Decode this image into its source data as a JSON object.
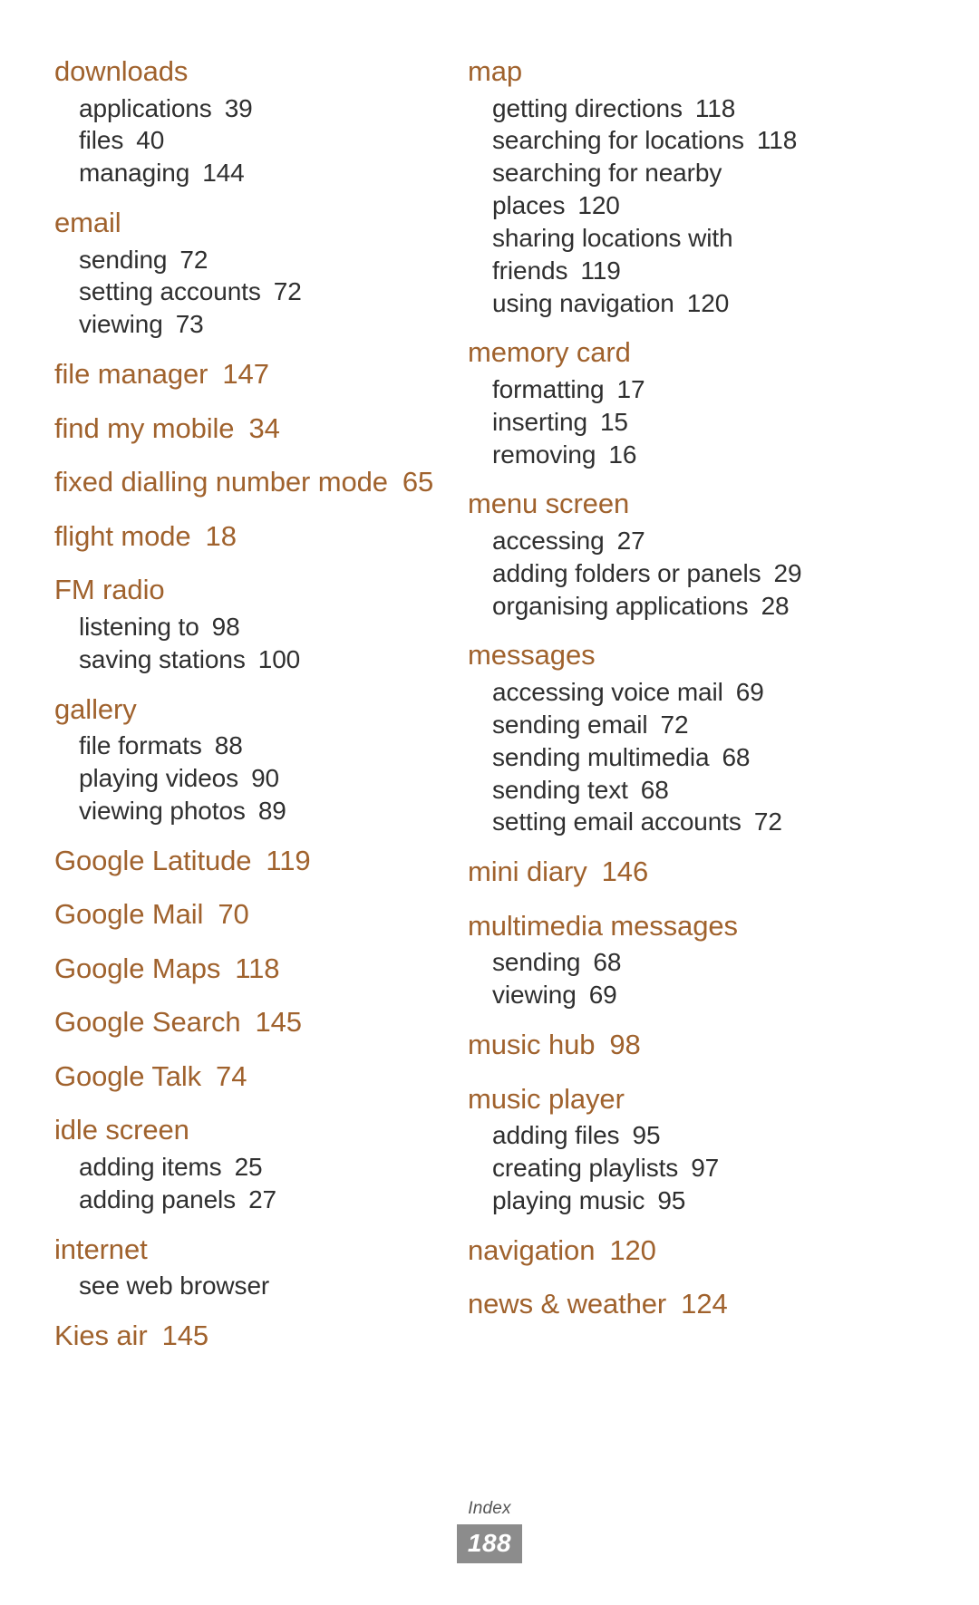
{
  "footer": {
    "label": "Index",
    "page_number": "188"
  },
  "colors": {
    "heading": "#a0622d",
    "entry": "#2f2f2f",
    "page_badge_bg": "#8c8c8c",
    "page_badge_text": "#ffffff",
    "background": "#ffffff"
  },
  "columns": [
    {
      "id": "left",
      "groups": [
        {
          "term": "downloads",
          "page": "",
          "entries": [
            {
              "term": "applications",
              "page": "39"
            },
            {
              "term": "files",
              "page": "40"
            },
            {
              "term": "managing",
              "page": "144"
            }
          ]
        },
        {
          "term": "email",
          "page": "",
          "entries": [
            {
              "term": "sending",
              "page": "72"
            },
            {
              "term": "setting accounts",
              "page": "72"
            },
            {
              "term": "viewing",
              "page": "73"
            }
          ]
        },
        {
          "term": "file manager",
          "page": "147",
          "entries": []
        },
        {
          "term": "find my mobile",
          "page": "34",
          "entries": []
        },
        {
          "term": "fixed dialling number mode",
          "page": "65",
          "entries": []
        },
        {
          "term": "flight mode",
          "page": "18",
          "entries": []
        },
        {
          "term": "FM radio",
          "page": "",
          "entries": [
            {
              "term": "listening to",
              "page": "98"
            },
            {
              "term": "saving stations",
              "page": "100"
            }
          ]
        },
        {
          "term": "gallery",
          "page": "",
          "entries": [
            {
              "term": "file formats",
              "page": "88"
            },
            {
              "term": "playing videos",
              "page": "90"
            },
            {
              "term": "viewing photos",
              "page": "89"
            }
          ]
        },
        {
          "term": "Google Latitude",
          "page": "119",
          "entries": []
        },
        {
          "term": "Google Mail",
          "page": "70",
          "entries": []
        },
        {
          "term": "Google Maps",
          "page": "118",
          "entries": []
        },
        {
          "term": "Google Search",
          "page": "145",
          "entries": []
        },
        {
          "term": "Google Talk",
          "page": "74",
          "entries": []
        },
        {
          "term": "idle screen",
          "page": "",
          "entries": [
            {
              "term": "adding items",
              "page": "25"
            },
            {
              "term": "adding panels",
              "page": "27"
            }
          ]
        },
        {
          "term": "internet",
          "page": "",
          "entries": [
            {
              "term": "see web browser",
              "page": ""
            }
          ]
        },
        {
          "term": "Kies air",
          "page": "145",
          "entries": []
        }
      ]
    },
    {
      "id": "right",
      "groups": [
        {
          "term": "map",
          "page": "",
          "entries": [
            {
              "term": "getting directions",
              "page": "118"
            },
            {
              "term": "searching for locations",
              "page": "118"
            },
            {
              "term": "searching for nearby places",
              "page": "120"
            },
            {
              "term": "sharing locations with friends",
              "page": "119"
            },
            {
              "term": "using navigation",
              "page": "120"
            }
          ]
        },
        {
          "term": "memory card",
          "page": "",
          "entries": [
            {
              "term": "formatting",
              "page": "17"
            },
            {
              "term": "inserting",
              "page": "15"
            },
            {
              "term": "removing",
              "page": "16"
            }
          ]
        },
        {
          "term": "menu screen",
          "page": "",
          "entries": [
            {
              "term": "accessing",
              "page": "27"
            },
            {
              "term": "adding folders or panels",
              "page": "29"
            },
            {
              "term": "organising applications",
              "page": "28"
            }
          ]
        },
        {
          "term": "messages",
          "page": "",
          "entries": [
            {
              "term": "accessing voice mail",
              "page": "69"
            },
            {
              "term": "sending email",
              "page": "72"
            },
            {
              "term": "sending multimedia",
              "page": "68"
            },
            {
              "term": "sending text",
              "page": "68"
            },
            {
              "term": "setting email accounts",
              "page": "72"
            }
          ]
        },
        {
          "term": "mini diary",
          "page": "146",
          "entries": []
        },
        {
          "term": "multimedia messages",
          "page": "",
          "entries": [
            {
              "term": "sending",
              "page": "68"
            },
            {
              "term": "viewing",
              "page": "69"
            }
          ]
        },
        {
          "term": "music hub",
          "page": "98",
          "entries": []
        },
        {
          "term": "music player",
          "page": "",
          "entries": [
            {
              "term": "adding files",
              "page": "95"
            },
            {
              "term": "creating playlists",
              "page": "97"
            },
            {
              "term": "playing music",
              "page": "95"
            }
          ]
        },
        {
          "term": "navigation",
          "page": "120",
          "entries": []
        },
        {
          "term": "news & weather",
          "page": "124",
          "entries": []
        }
      ]
    }
  ]
}
